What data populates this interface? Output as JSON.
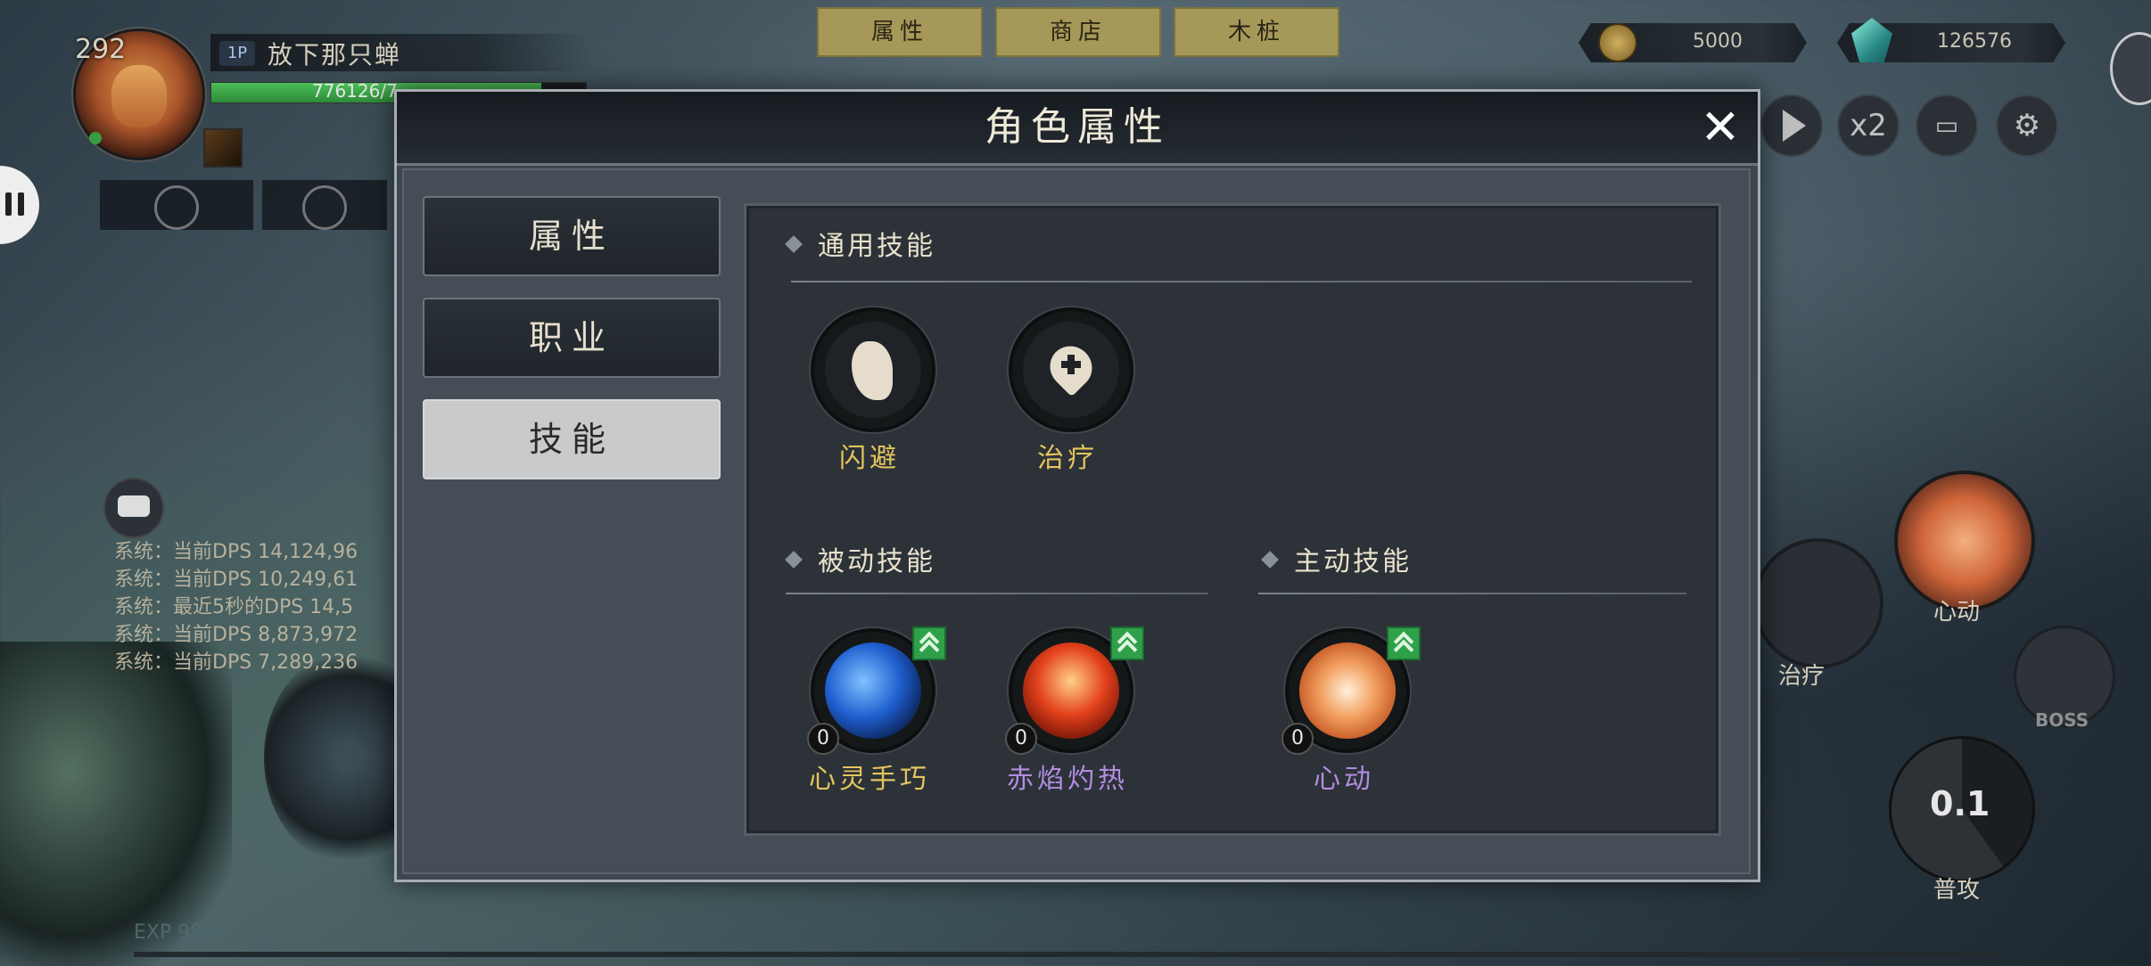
{
  "player": {
    "level": "292",
    "tag": "1P",
    "name": "放下那只蝉",
    "hp_text": "776126/7",
    "hp_fraction": 0.88
  },
  "chat": {
    "lines": [
      "系统：当前DPS 14,124,96",
      "系统：当前DPS 10,249,61",
      "系统：最近5秒的DPS 14,5",
      "系统：当前DPS 8,873,972",
      "系统：当前DPS 7,289,236"
    ]
  },
  "top_menu": [
    "属性",
    "商店",
    "木桩"
  ],
  "currency": {
    "coins": "5000",
    "gems": "126576"
  },
  "controls": {
    "speed": "x2"
  },
  "right_hud": {
    "skill_label": "心动",
    "heal_label": "治疗",
    "boss_label": "BOSS",
    "attack_cd": "0.1",
    "attack_label": "普攻"
  },
  "exp": {
    "label": "EXP 99%"
  },
  "modal": {
    "title": "角色属性",
    "close": "✕",
    "tabs": [
      "属性",
      "职业",
      "技能"
    ],
    "active_tab": "技能",
    "sections": {
      "general": {
        "title": "通用技能",
        "skills": [
          {
            "name": "闪避",
            "icon": "dodge-foot-icon"
          },
          {
            "name": "治疗",
            "icon": "heal-heart-icon"
          }
        ]
      },
      "passive": {
        "title": "被动技能",
        "skills": [
          {
            "name": "心灵手巧",
            "level": "0",
            "icon": "blue-dash-icon",
            "upgradable": true
          },
          {
            "name": "赤焰灼热",
            "level": "0",
            "icon": "fire-dragon-icon",
            "upgradable": true
          }
        ]
      },
      "active": {
        "title": "主动技能",
        "skills": [
          {
            "name": "心动",
            "level": "0",
            "icon": "heart-swirl-icon",
            "upgradable": true
          }
        ]
      }
    }
  },
  "colors": {
    "gold_name": "#e3c55e",
    "purple_name": "#b38ce0",
    "upgrade_green": "#2fa04a",
    "menu_tab": "#a69858"
  }
}
